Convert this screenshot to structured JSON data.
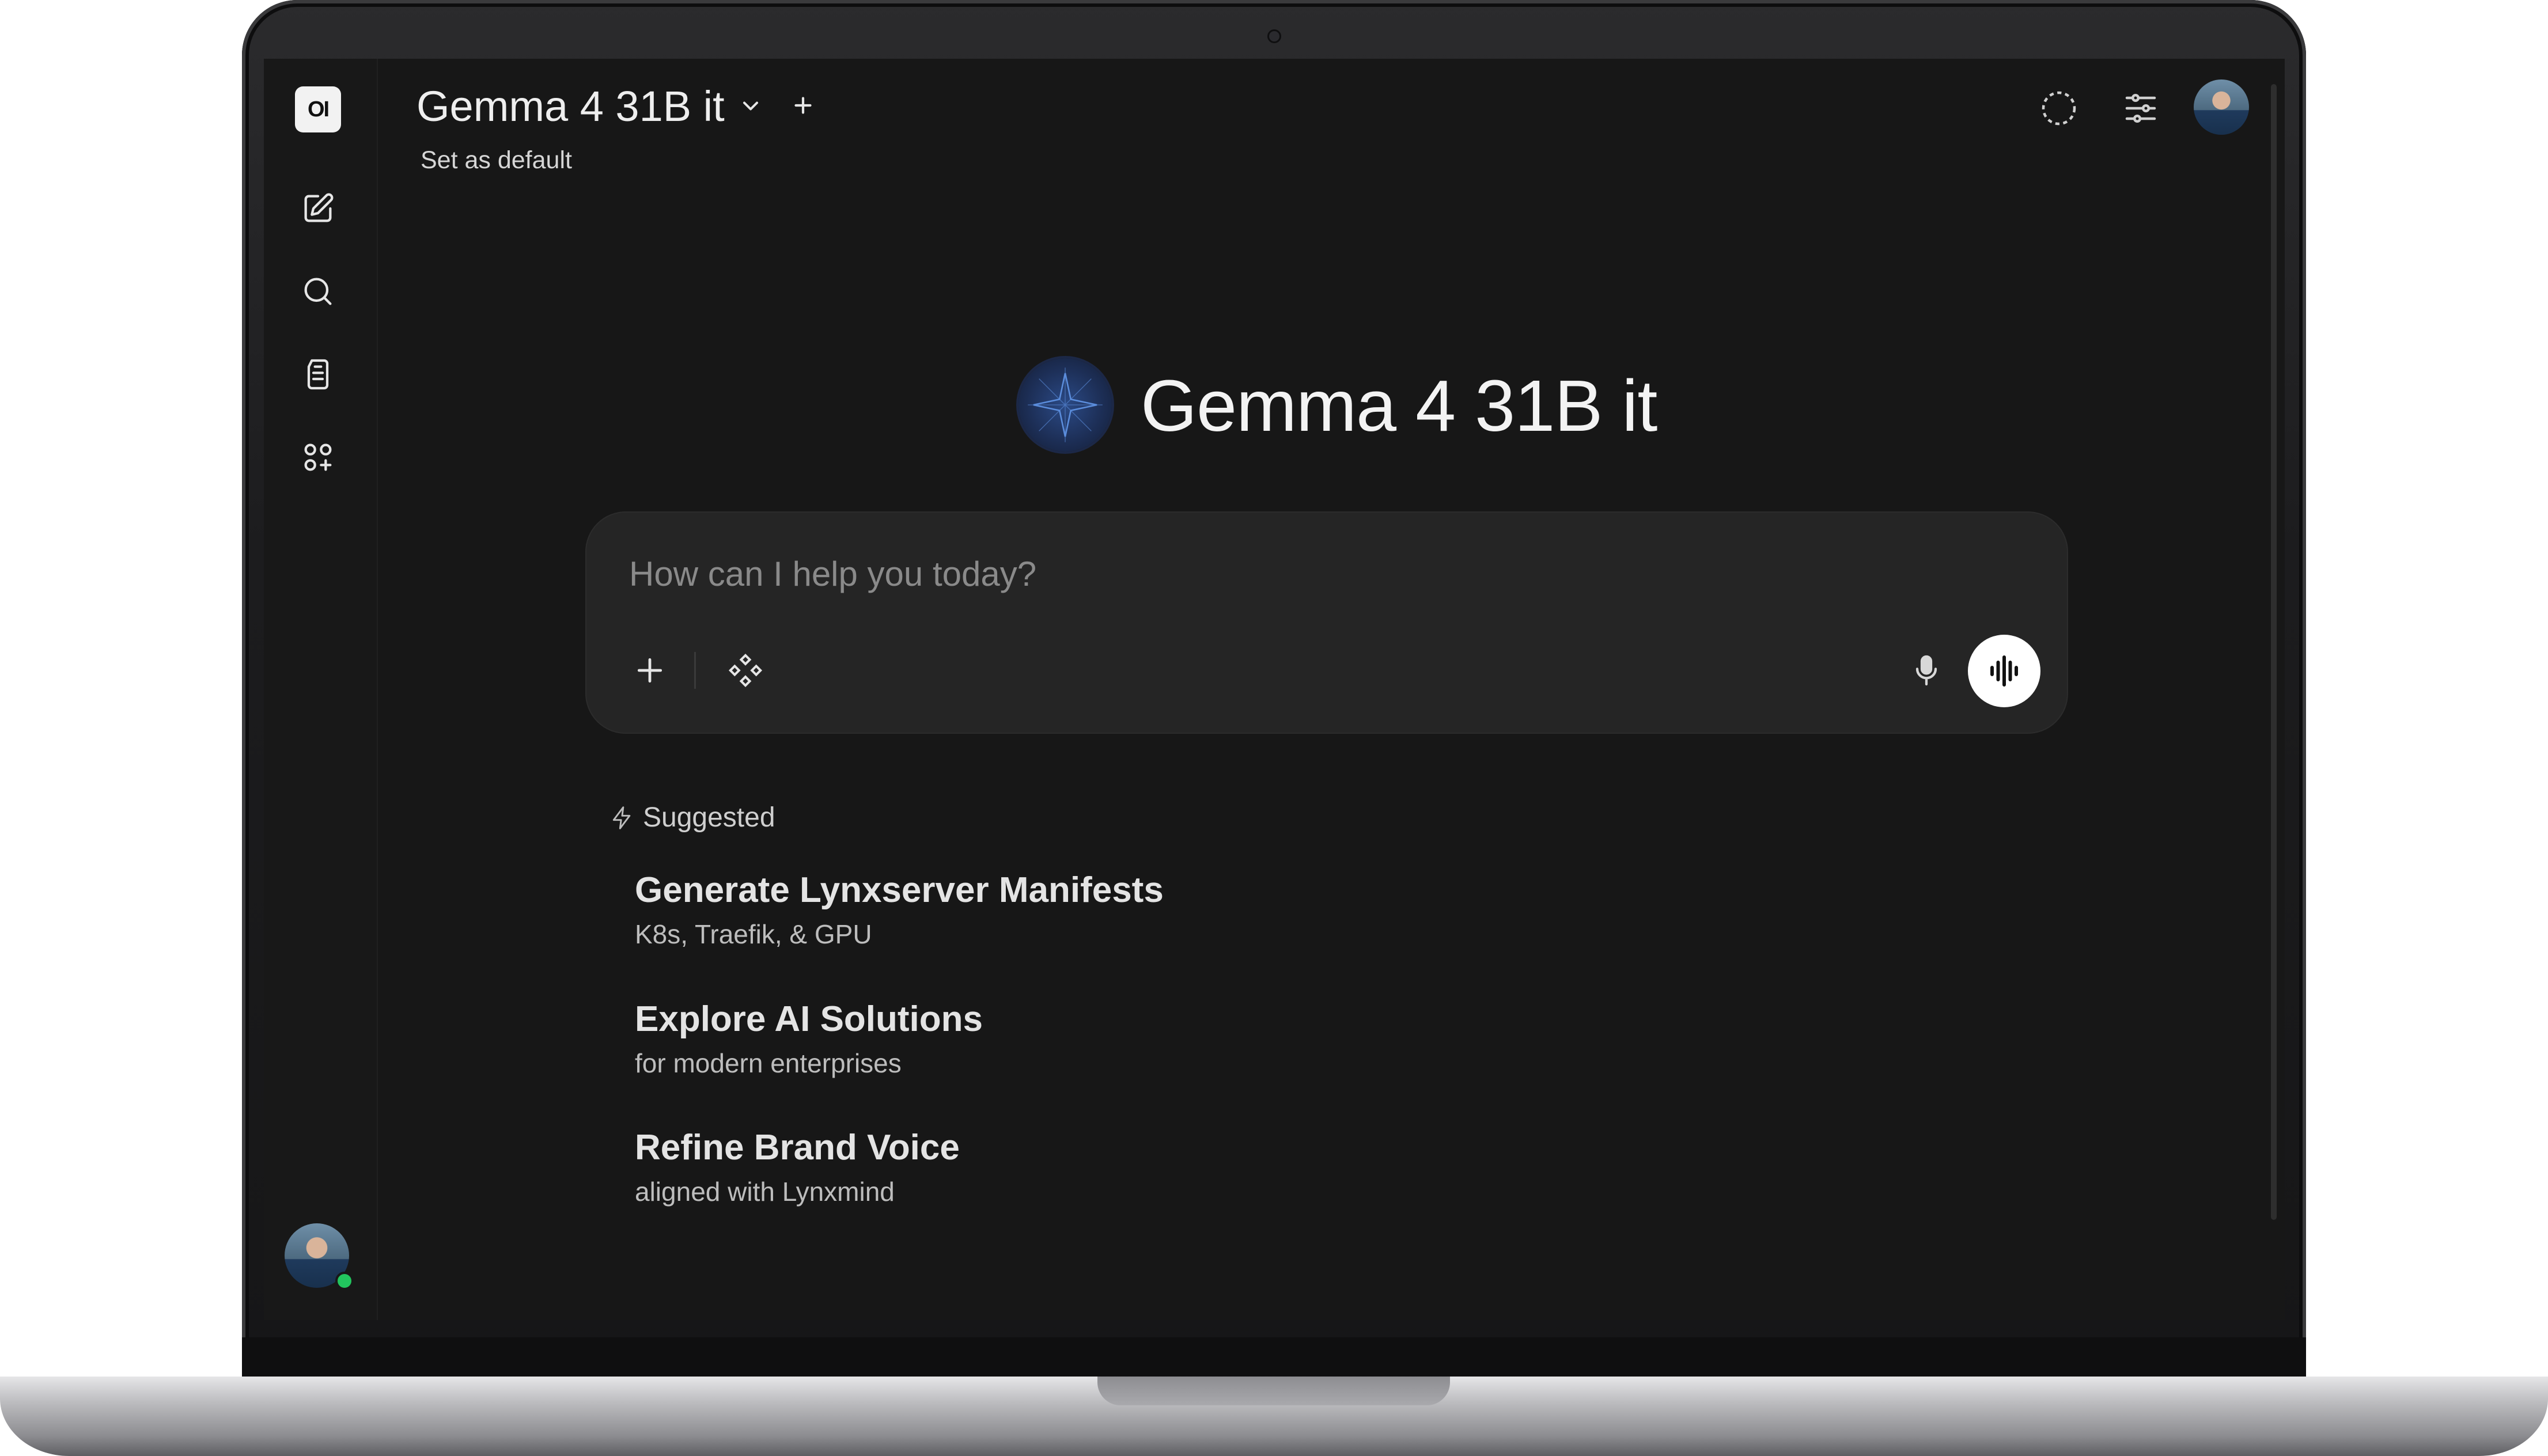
{
  "app": {
    "logo_text": "OI"
  },
  "header": {
    "model_name": "Gemma 4 31B it",
    "set_default_label": "Set as default"
  },
  "hero": {
    "model_name": "Gemma 4 31B it"
  },
  "composer": {
    "placeholder": "How can I help you today?",
    "value": ""
  },
  "suggestions": {
    "heading": "Suggested",
    "items": [
      {
        "title": "Generate Lynxserver Manifests",
        "subtitle": "K8s, Traefik, & GPU"
      },
      {
        "title": "Explore AI Solutions",
        "subtitle": "for modern enterprises"
      },
      {
        "title": "Refine Brand Voice",
        "subtitle": "aligned with Lynxmind"
      }
    ]
  },
  "icons": {
    "sidebar": [
      "new-chat-icon",
      "search-icon",
      "notes-icon",
      "workspace-icon"
    ],
    "top_right": [
      "temporary-chat-icon",
      "controls-icon",
      "user-avatar"
    ],
    "composer": [
      "add-icon",
      "integrations-icon",
      "microphone-icon",
      "voice-mode-icon"
    ]
  },
  "colors": {
    "background": "#171717",
    "composer_bg": "#252525",
    "online_status": "#22c55e",
    "hero_logo": "#2b4a86"
  }
}
